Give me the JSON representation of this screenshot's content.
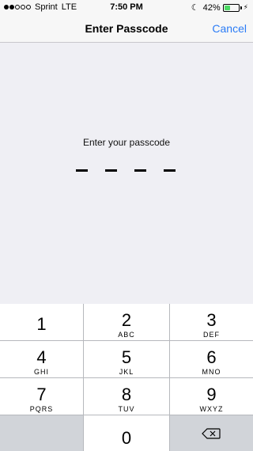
{
  "status_bar": {
    "carrier": "Sprint",
    "network": "LTE",
    "time": "7:50 PM",
    "battery_percent": "42%",
    "battery_level": 0.42,
    "signal_bars": 2,
    "icons": [
      "moon-icon",
      "battery-icon",
      "charging-bolt-icon"
    ]
  },
  "nav": {
    "title": "Enter Passcode",
    "cancel_label": "Cancel"
  },
  "passcode": {
    "prompt": "Enter your passcode",
    "length": 4
  },
  "keypad": {
    "keys": [
      {
        "digit": "1",
        "letters": ""
      },
      {
        "digit": "2",
        "letters": "ABC"
      },
      {
        "digit": "3",
        "letters": "DEF"
      },
      {
        "digit": "4",
        "letters": "GHI"
      },
      {
        "digit": "5",
        "letters": "JKL"
      },
      {
        "digit": "6",
        "letters": "MNO"
      },
      {
        "digit": "7",
        "letters": "PQRS"
      },
      {
        "digit": "8",
        "letters": "TUV"
      },
      {
        "digit": "9",
        "letters": "WXYZ"
      },
      {
        "digit": "0",
        "letters": ""
      }
    ],
    "delete_icon": "backspace-icon"
  },
  "colors": {
    "accent": "#2b7cf6",
    "battery": "#4cd964",
    "background": "#efeff4"
  }
}
